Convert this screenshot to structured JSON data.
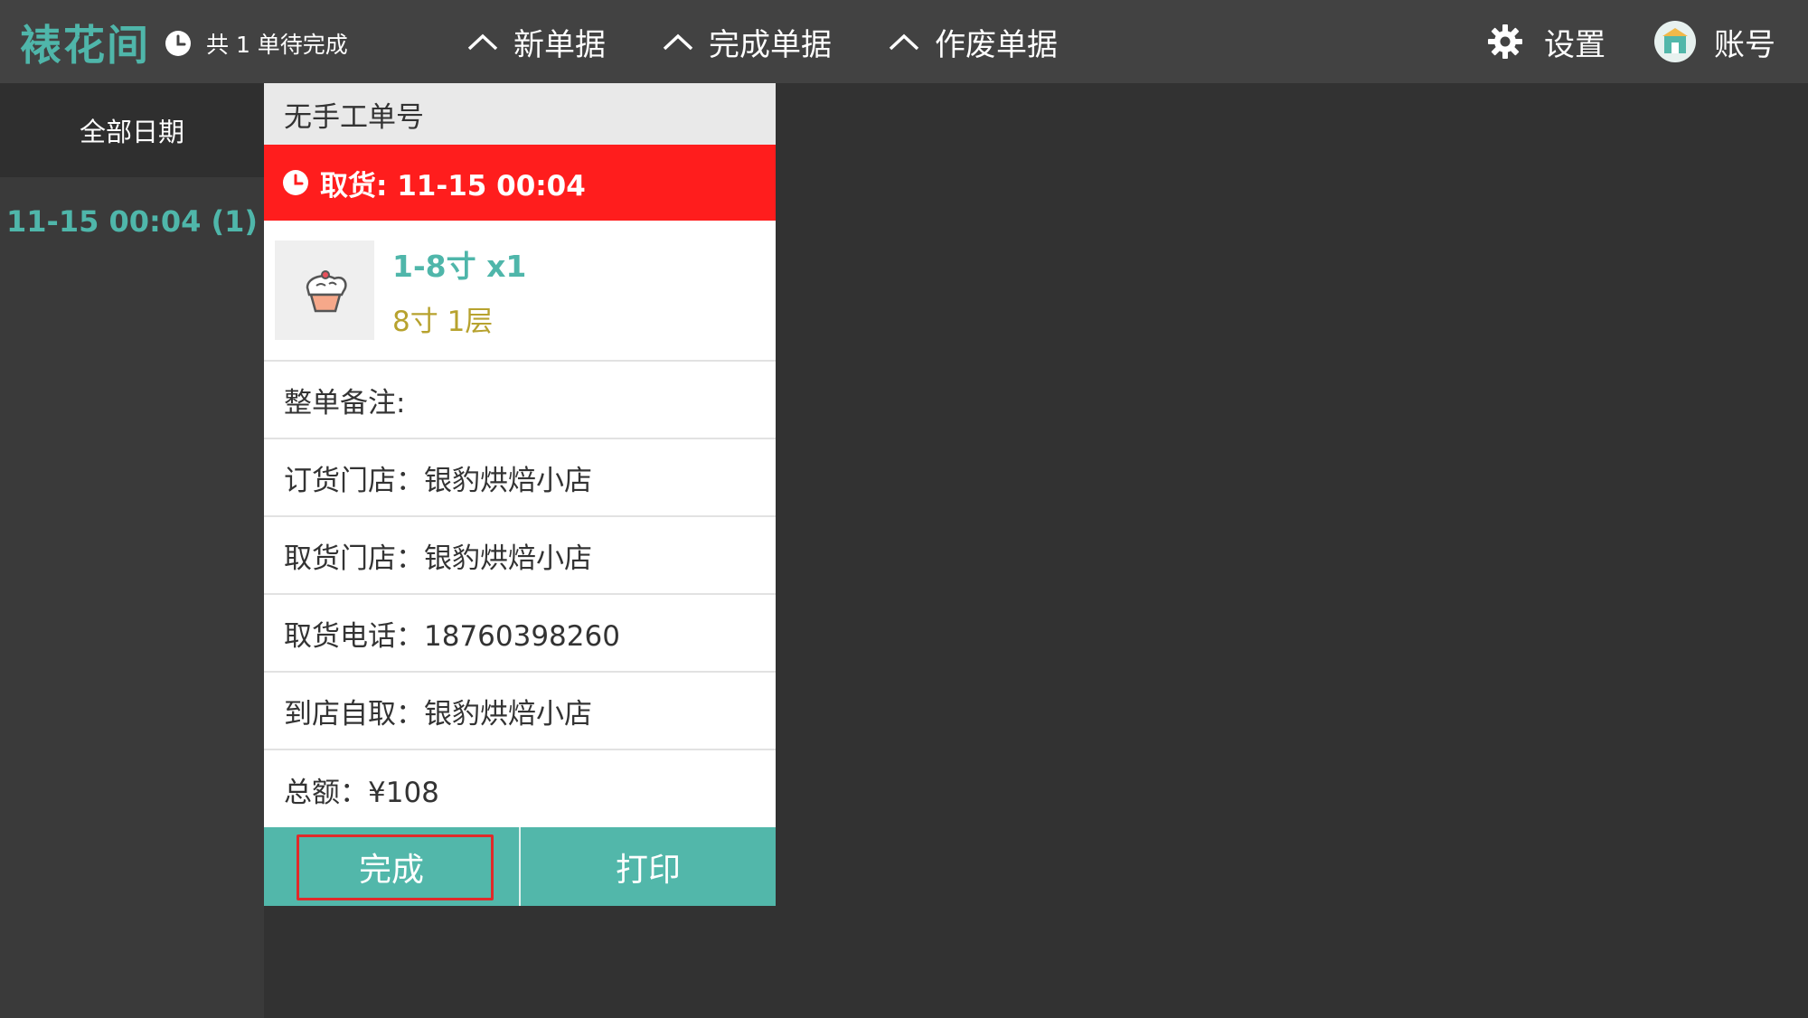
{
  "header": {
    "brand": "裱花间",
    "pending_text": "共 1 单待完成",
    "nav": {
      "new_orders": "新单据",
      "completed_orders": "完成单据",
      "void_orders": "作废单据"
    },
    "settings": "设置",
    "account": "账号"
  },
  "sidebar": {
    "all_dates": "全部日期",
    "dates": [
      {
        "label": "11-15 00:04 (1)"
      }
    ]
  },
  "order": {
    "order_no": "无手工单号",
    "pickup": "取货: 11-15 00:04",
    "item": {
      "name": "1-8寸 x1",
      "spec": "8寸 1层",
      "icon": "cake-icon"
    },
    "rows": {
      "remark": "整单备注:",
      "order_store": "订货门店：银豹烘焙小店",
      "pickup_store": "取货门店：银豹烘焙小店",
      "pickup_phone": "取货电话：18760398260",
      "self_pickup": "到店自取：银豹烘焙小店",
      "total": "总额：¥108"
    },
    "actions": {
      "complete": "完成",
      "print": "打印"
    }
  },
  "colors": {
    "accent": "#4fb6aa",
    "alert": "#ff1d1d",
    "spec": "#b7a22e",
    "button": "#52b7aa"
  }
}
